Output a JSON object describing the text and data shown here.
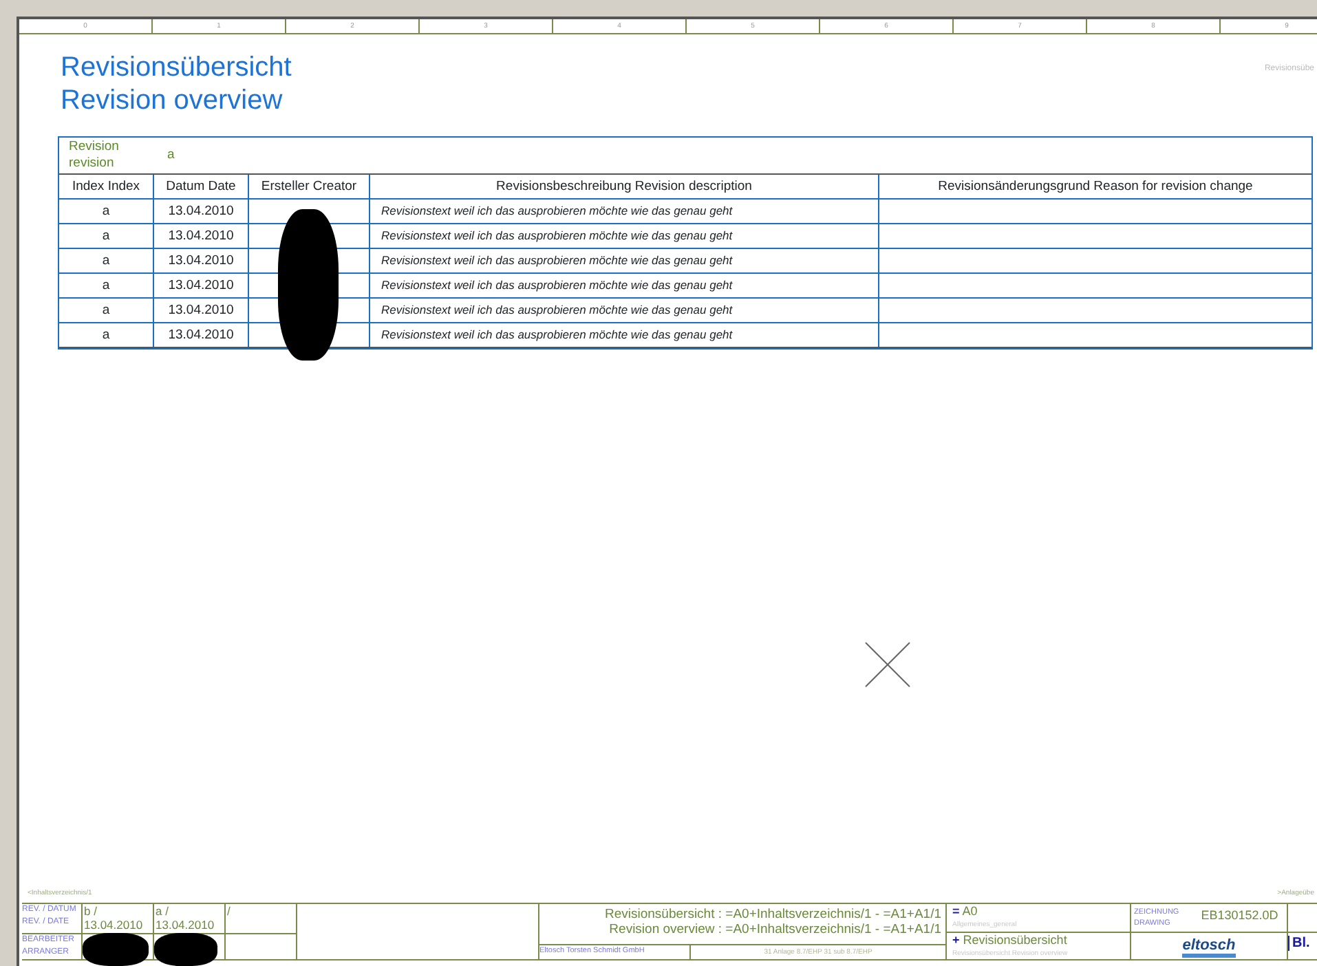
{
  "ruler": [
    "0",
    "1",
    "2",
    "3",
    "4",
    "5",
    "6",
    "7",
    "8",
    "9"
  ],
  "corner_text": "Revisionsübe",
  "title": [
    "Revisionsübersicht",
    "Revision overview"
  ],
  "revision_table": {
    "revision_label": [
      "Revision",
      "revision"
    ],
    "revision_value": "a",
    "columns": [
      "Index Index",
      "Datum Date",
      "Ersteller Creator",
      "Revisionsbeschreibung Revision description",
      "Revisionsänderungsgrund Reason for revision change"
    ],
    "rows": [
      {
        "index": "a",
        "date": "13.04.2010",
        "description": "Revisionstext weil ich das ausprobieren möchte wie das genau geht"
      },
      {
        "index": "a",
        "date": "13.04.2010",
        "description": "Revisionstext weil ich das ausprobieren möchte wie das genau geht"
      },
      {
        "index": "a",
        "date": "13.04.2010",
        "description": "Revisionstext weil ich das ausprobieren möchte wie das genau geht"
      },
      {
        "index": "a",
        "date": "13.04.2010",
        "description": "Revisionstext weil ich das ausprobieren möchte wie das genau geht"
      },
      {
        "index": "a",
        "date": "13.04.2010",
        "description": "Revisionstext weil ich das ausprobieren möchte wie das genau geht"
      },
      {
        "index": "a",
        "date": "13.04.2010",
        "description": "Revisionstext weil ich das ausprobieren möchte wie das genau geht"
      }
    ]
  },
  "footer": {
    "previous_page": "<Inhaltsverzeichnis/1",
    "next_page": ">Anlageübe"
  },
  "title_block": {
    "rev_label": [
      "REV. / DATUM",
      "REV. / DATE"
    ],
    "revisions": [
      {
        "rev": "b  /",
        "date": "13.04.2010"
      },
      {
        "rev": "a  /",
        "date": "13.04.2010"
      },
      {
        "rev": "/"
      }
    ],
    "arranger_label": [
      "BEARBEITER",
      "ARRANGER"
    ],
    "description": [
      "Revisionsübersicht : =A0+Inhaltsverzeichnis/1 - =A1+A1/1",
      "Revision overview : =A0+Inhaltsverzeichnis/1 - =A1+A1/1"
    ],
    "company": "Eltosch Torsten Schmidt GmbH",
    "project": "31 Anlage 8.7/EHP 31 sub 8.7/EHP",
    "plant": {
      "sign": "=",
      "value": "A0",
      "note": "Allgemeines_general"
    },
    "location": {
      "sign": "+",
      "value": "Revisionsübersicht",
      "note": "Revisionsübersicht Revision overview"
    },
    "drawing_label": [
      "ZEICHNUNG",
      "DRAWING"
    ],
    "drawing_number": "EB130152.0D",
    "logo": "eltosch",
    "sheet_label": "Bl."
  }
}
